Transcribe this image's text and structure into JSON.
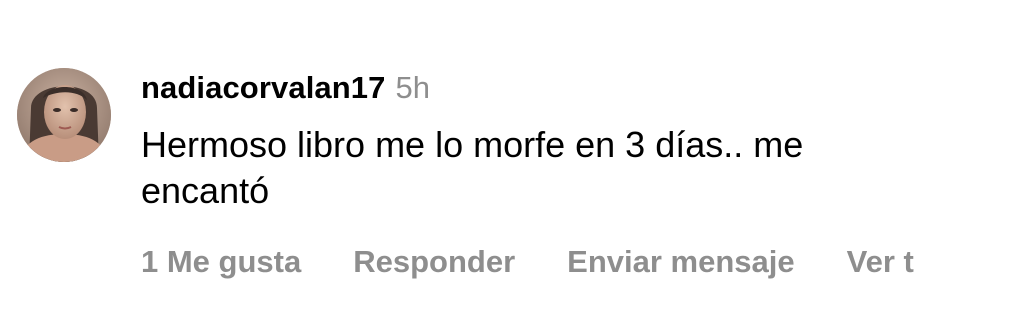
{
  "comment": {
    "username": "nadiacorvalan17",
    "timestamp": "5h",
    "text": "Hermoso libro me lo morfe en 3 días.. me\nencantó",
    "avatar_icon": "user-avatar-photo",
    "actions": {
      "likes_label": "1 Me gusta",
      "reply_label": "Responder",
      "send_message_label": "Enviar mensaje",
      "view_translation_label": "Ver t"
    }
  },
  "colors": {
    "text_primary": "#000000",
    "text_secondary": "#8e8e8e",
    "background": "#ffffff"
  }
}
